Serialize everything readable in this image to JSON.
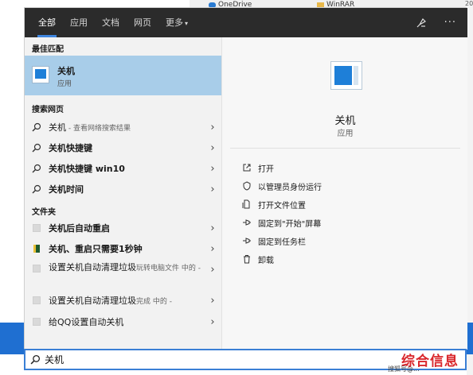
{
  "background": {
    "files": [
      {
        "name": "OneDrive",
        "icon": "onedrive-icon"
      },
      {
        "name": "WinRAR",
        "icon": "winrar-icon"
      }
    ],
    "edge_text": "20"
  },
  "tabs": [
    {
      "label": "全部"
    },
    {
      "label": "应用"
    },
    {
      "label": "文档"
    },
    {
      "label": "网页"
    },
    {
      "label": "更多"
    }
  ],
  "top_icons": [
    "feedback-icon",
    "more-options-icon"
  ],
  "more_caret": "▾",
  "more_dots": "···",
  "best_match": {
    "header": "最佳匹配",
    "title": "关机",
    "subtitle": "应用"
  },
  "web": {
    "header": "搜索网页",
    "items": [
      {
        "bold": "关机",
        "rest": " - 查看网络搜索结果"
      },
      {
        "bold": "关机快捷键",
        "rest": ""
      },
      {
        "bold": "关机快捷键 win10",
        "rest": ""
      },
      {
        "bold": "关机时间",
        "rest": ""
      }
    ]
  },
  "folders": {
    "header": "文件夹",
    "items": [
      {
        "bold": "关机后自动重启",
        "rest": ""
      },
      {
        "bold": "关机、重启只需要1秒钟",
        "rest": ""
      },
      {
        "bold": "设置关机自动清理垃圾",
        "rest": "玩转电脑文件 中的 -"
      },
      {
        "bold": "设置关机自动清理垃圾",
        "rest": "完成 中的 -"
      },
      {
        "bold": "给QQ设置自动关机",
        "rest": ""
      }
    ]
  },
  "chevron": "›",
  "preview": {
    "title": "关机",
    "subtitle": "应用",
    "actions": [
      {
        "label": "打开",
        "icon": "open-icon"
      },
      {
        "label": "以管理员身份运行",
        "icon": "run-as-admin-icon"
      },
      {
        "label": "打开文件位置",
        "icon": "file-location-icon"
      },
      {
        "label": "固定到\"开始\"屏幕",
        "icon": "pin-start-icon"
      },
      {
        "label": "固定到任务栏",
        "icon": "pin-taskbar-icon"
      },
      {
        "label": "卸载",
        "icon": "uninstall-icon"
      }
    ]
  },
  "search": {
    "value": "关机"
  },
  "watermark": {
    "main": "综合信息",
    "sub": "搜狐号@..."
  }
}
